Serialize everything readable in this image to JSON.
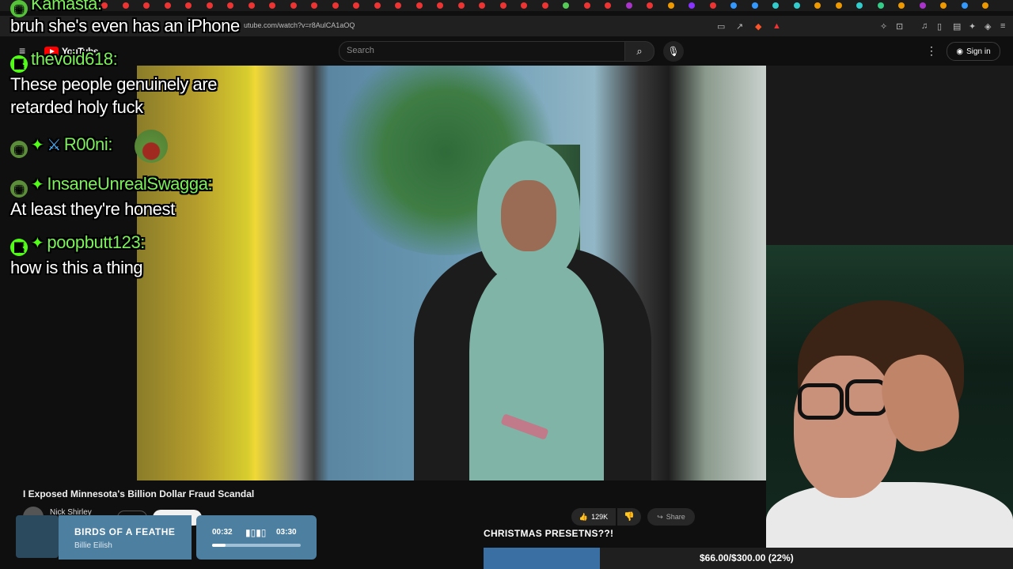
{
  "browser": {
    "url": "utube.com/watch?v=r8AulCA1aOQ"
  },
  "youtube": {
    "logo_text": "YouTube",
    "search_placeholder": "Search",
    "signin_label": "Sign in"
  },
  "chat": [
    {
      "user": "Kamasta:",
      "message": "bruh she's even has an iPhone"
    },
    {
      "user": "thevoid618:",
      "message": "These people genuinely are"
    },
    {
      "user": "",
      "message": "retarded holy fuck"
    },
    {
      "user": "R00ni:",
      "message": ""
    },
    {
      "user": "InsaneUnrealSwagga:",
      "message": "At least they're honest"
    },
    {
      "user": "poopbutt123:",
      "message": "how is this a thing"
    }
  ],
  "video": {
    "title": "I Exposed Minnesota's Billion Dollar Fraud Scandal",
    "channel": "Nick Shirley",
    "likes": "129K",
    "share_label": "Share"
  },
  "music": {
    "title": "BIRDS OF A FEATHE",
    "artist": "Billie Eilish",
    "elapsed": "00:32",
    "duration": "03:30",
    "progress": 0.15
  },
  "goal": {
    "label": "CHRISTMAS PRESETNS??!",
    "text": "$66.00/$300.00 (22%)",
    "progress": 0.22
  },
  "colors": {
    "chat_username": "#7cf05a",
    "kick_green": "#53fc18",
    "goal_fill": "#3a6fa3",
    "music_card": "#4d7fa0"
  }
}
